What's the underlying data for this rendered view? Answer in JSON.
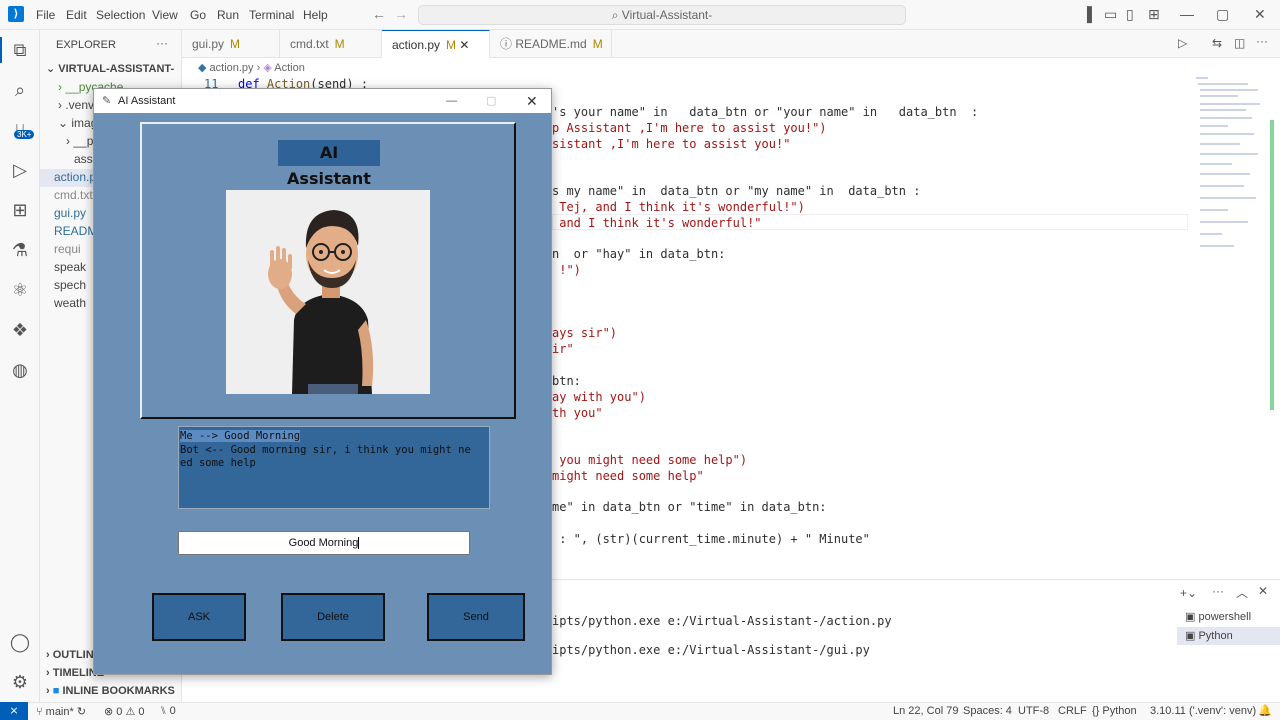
{
  "menu": [
    "File",
    "Edit",
    "Selection",
    "View",
    "Go",
    "Run",
    "Terminal",
    "Help"
  ],
  "command_center": "Virtual-Assistant-",
  "sidebar": {
    "title": "EXPLORER",
    "root": "VIRTUAL-ASSISTANT-",
    "items": [
      "__pycache__",
      ".venv",
      "images",
      "__py",
      "assi",
      "action.py",
      "cmd.txt",
      "gui.py",
      "README.md",
      "requi",
      "speak",
      "spech",
      "weath"
    ],
    "outline": "OUTLINE",
    "timeline": "TIMELINE",
    "bookmarks": "INLINE BOOKMARKS"
  },
  "tabs": [
    {
      "label": "gui.py",
      "badge": "M"
    },
    {
      "label": "cmd.txt",
      "badge": "M"
    },
    {
      "label": "action.py",
      "badge": "M"
    },
    {
      "label": "README.md",
      "badge": "M"
    }
  ],
  "breadcrumb": {
    "file": "action.py",
    "symbol": "Action"
  },
  "code": {
    "line_no": "11",
    "line_def": "def Action(send) :",
    "lines": [
      "'s your name\" in   data_btn or \"your name\" in   data_btn  :",
      "p Assistant ,I'm here to assist you!\")",
      "sistant ,I'm here to assist you!\"",
      "s my name\" in  data_btn or \"my name\" in  data_btn :",
      " Tej, and I think it's wonderful!\")",
      " and I think it's wonderful!\"",
      "n  or \"hay\" in data_btn:",
      " !\")",
      "ays sir\")",
      "ir\"",
      "btn:",
      "ay with you\")",
      "th you\"",
      " you might need some help\")",
      "might need some help\"",
      "me\" in data_btn or \"time\" in data_btn:",
      " : \", (str)(current_time.minute) + \" Minute\""
    ]
  },
  "terminal": {
    "lines": [
      "ipts/python.exe e:/Virtual-Assistant-/action.py",
      "ipts/python.exe e:/Virtual-Assistant-/gui.py"
    ],
    "shells": [
      "powershell",
      "Python"
    ]
  },
  "status": {
    "branch": "main*",
    "errors": "0",
    "warnings": "0",
    "ports": "0",
    "position": "Ln 22, Col 79",
    "spaces": "Spaces: 4",
    "encoding": "UTF-8",
    "eol": "CRLF",
    "language": "Python",
    "interpreter": "3.10.11 ('.venv': venv)"
  },
  "app": {
    "window_title": "AI Assistant",
    "heading": "AI Assistant",
    "chat_line1": "Me --> Good Morning",
    "chat_line2": "Bot <-- Good morning sir, i think you might ne",
    "chat_line3": "ed some help",
    "entry_value": "Good Morning",
    "btn_ask": "ASK",
    "btn_delete": "Delete",
    "btn_send": "Send"
  },
  "badges": {
    "activity_count": "3K+"
  },
  "colors": {
    "accent": "#005fb8",
    "app_bg": "#6b8fb5",
    "app_button": "#336699"
  }
}
